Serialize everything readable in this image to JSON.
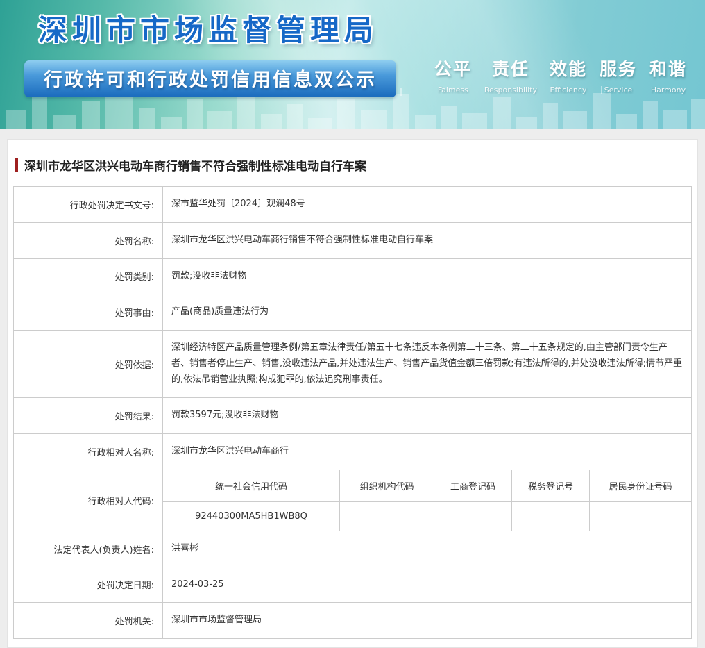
{
  "colors": {
    "title_blue": "#1668c7",
    "ribbon_blue": "#1a6bbd",
    "accent_red": "#9e1f1f",
    "banner_teal": "#2ea195"
  },
  "header": {
    "site_title": "深圳市市场监督管理局",
    "banner_subtitle": "行政许可和行政处罚信用信息双公示",
    "slogan": [
      {
        "cn": "公平",
        "en": "Faimess"
      },
      {
        "cn": "责任",
        "en": "Responsibility"
      },
      {
        "cn": "效能",
        "en": "Efficiency"
      },
      {
        "cn": "服务",
        "en": "Service"
      },
      {
        "cn": "和谐",
        "en": "Harmony"
      }
    ]
  },
  "case": {
    "title": "深圳市龙华区洪兴电动车商行销售不符合强制性标准电动自行车案",
    "rows": [
      {
        "label": "行政处罚决定书文号:",
        "value": "深市监华处罚〔2024〕观澜48号"
      },
      {
        "label": "处罚名称:",
        "value": "深圳市龙华区洪兴电动车商行销售不符合强制性标准电动自行车案"
      },
      {
        "label": "处罚类别:",
        "value": "罚款;没收非法财物"
      },
      {
        "label": "处罚事由:",
        "value": "产品(商品)质量违法行为"
      },
      {
        "label": "处罚依据:",
        "value": "深圳经济特区产品质量管理条例/第五章法律责任/第五十七条违反本条例第二十三条、第二十五条规定的,由主管部门责令生产者、销售者停止生产、销售,没收违法产品,并处违法生产、销售产品货值金额三倍罚款;有违法所得的,并处没收违法所得;情节严重的,依法吊销营业执照;构成犯罪的,依法追究刑事责任。"
      },
      {
        "label": "处罚结果:",
        "value": "罚款3597元;没收非法财物"
      },
      {
        "label": "行政相对人名称:",
        "value": "深圳市龙华区洪兴电动车商行"
      }
    ],
    "party_code": {
      "label": "行政相对人代码:",
      "columns": [
        "统一社会信用代码",
        "组织机构代码",
        "工商登记码",
        "税务登记号",
        "居民身份证号码"
      ],
      "values": [
        "92440300MA5HB1WB8Q",
        "",
        "",
        "",
        ""
      ]
    },
    "rows2": [
      {
        "label": "法定代表人(负责人)姓名:",
        "value": "洪喜彬"
      },
      {
        "label": "处罚决定日期:",
        "value": "2024-03-25"
      },
      {
        "label": "处罚机关:",
        "value": "深圳市市场监督管理局"
      }
    ]
  }
}
